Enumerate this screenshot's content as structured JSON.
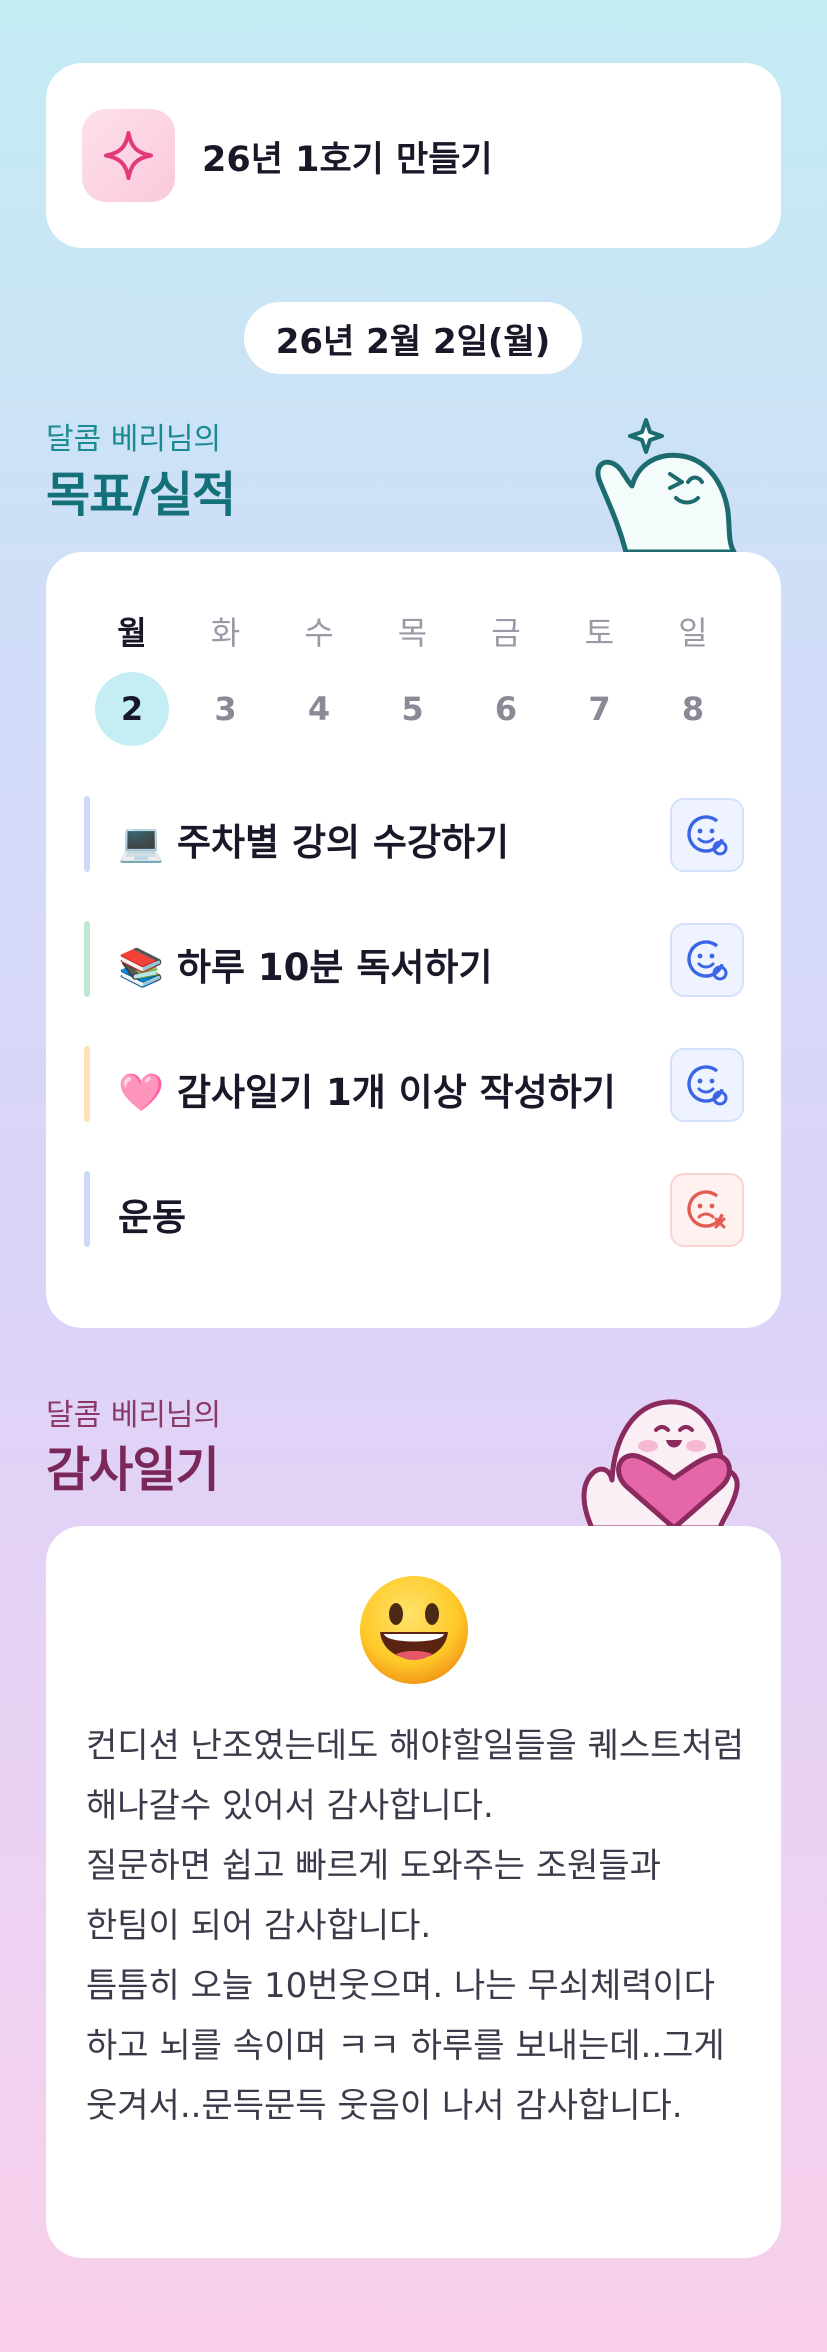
{
  "header": {
    "title": "26년 1호기 만들기",
    "icon": "sparkle-icon"
  },
  "date": "26년 2월 2일(월)",
  "goals_section": {
    "subtitle": "달콤 베리님의",
    "title": "목표/실적"
  },
  "week": {
    "days": [
      {
        "name": "월",
        "date": "2",
        "active": true
      },
      {
        "name": "화",
        "date": "3"
      },
      {
        "name": "수",
        "date": "4"
      },
      {
        "name": "목",
        "date": "5"
      },
      {
        "name": "금",
        "date": "6"
      },
      {
        "name": "토",
        "date": "7"
      },
      {
        "name": "일",
        "date": "8"
      }
    ]
  },
  "goals": [
    {
      "label": "💻 주차별 강의 수강하기",
      "bar_color": "#cdd9f5",
      "status": "smile-icon"
    },
    {
      "label": "📚 하루 10분 독서하기",
      "bar_color": "#bde9d2",
      "status": "smile-icon"
    },
    {
      "label": "🩷 감사일기 1개 이상 작성하기",
      "bar_color": "#fbe2b8",
      "status": "smile-icon"
    },
    {
      "label": "운동",
      "bar_color": "#cdd9f5",
      "status": "sad-x-icon"
    }
  ],
  "gratitude_section": {
    "subtitle": "달콤 베리님의",
    "title": "감사일기"
  },
  "gratitude": {
    "mood": "grinning-face-icon",
    "text": "컨디션 난조였는데도 해야할일들을 퀘스트처럼 해나갈수 있어서 감사합니다.\n질문하면 쉽고 빠르게 도와주는 조원들과 한팀이 되어 감사합니다.\n틈틈히 오늘 10번웃으며. 나는 무쇠체력이다 하고 뇌를 속이며 ㅋㅋ 하루를 보내는데..그게 웃겨서..문득문득 웃음이 나서 감사합니다."
  },
  "colors": {
    "teal": "#1a8b90",
    "plum": "#8b3867",
    "accent_blue": "#3a66e6",
    "accent_red": "#e25c52"
  }
}
